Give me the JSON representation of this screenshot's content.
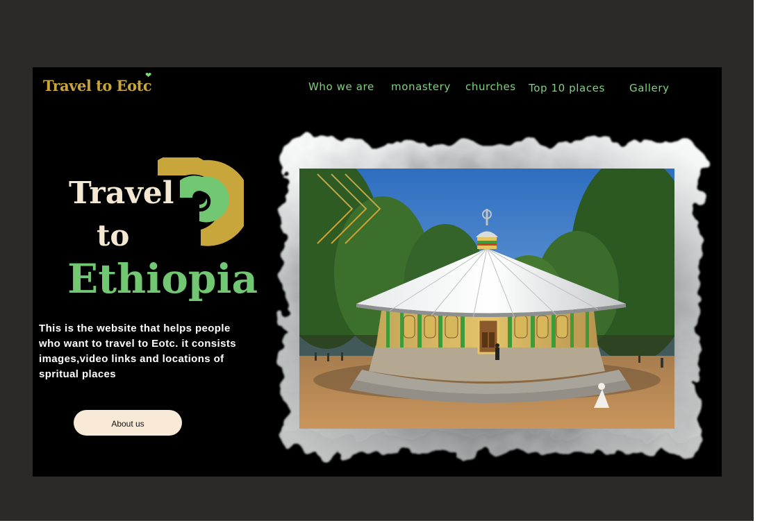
{
  "colors": {
    "accent_gold": "#c9a63b",
    "nav_green": "#7ed47e",
    "hero_cream": "#f4e8d2",
    "hero_green": "#72c872",
    "button_bg": "#f8ead6"
  },
  "header": {
    "logo": "Travel to Eotc",
    "logo_icon": "heart-icon"
  },
  "nav": {
    "items": [
      "Who we are",
      "monastery",
      "churches",
      "Top 10 places",
      "Gallery"
    ]
  },
  "hero": {
    "title_line1": "Travel",
    "title_line2": "to",
    "title_line3": "Ethiopia",
    "description": " This is the website that helps people\n who  want to travel to Eotc. it consists\nimages,video links and locations of\n spritual places",
    "button_label": "About us"
  },
  "image": {
    "subject": "round church with tin roof under blue sky"
  }
}
